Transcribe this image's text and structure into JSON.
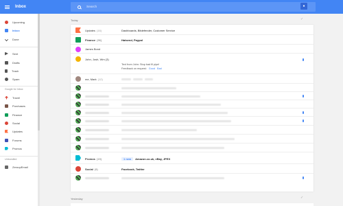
{
  "header": {
    "app_title": "Inbox",
    "search_placeholder": "Search"
  },
  "sidebar": {
    "items": [
      {
        "label": "Upcoming",
        "icon": "clock-icon",
        "color": "#db4437"
      },
      {
        "label": "Inbox",
        "icon": "inbox-icon",
        "color": "#4285f4",
        "active": true
      },
      {
        "label": "Done",
        "icon": "check-icon",
        "color": "#0f9d58"
      },
      {
        "label": "Sent",
        "icon": "send-icon",
        "color": "#555555"
      },
      {
        "label": "Drafts",
        "icon": "drafts-icon",
        "color": "#555555"
      },
      {
        "label": "Trash",
        "icon": "trash-icon",
        "color": "#555555"
      },
      {
        "label": "Spam",
        "icon": "spam-icon",
        "color": "#555555"
      }
    ],
    "bundles_header": "Google for Inbox",
    "bundles": [
      {
        "label": "Travel",
        "icon": "plane-icon",
        "color": "#db4437"
      },
      {
        "label": "Purchases",
        "icon": "cart-icon",
        "color": "#795548"
      },
      {
        "label": "Finance",
        "icon": "finance-icon",
        "color": "#0f9d58"
      },
      {
        "label": "Social",
        "icon": "social-icon",
        "color": "#db4437"
      },
      {
        "label": "Updates",
        "icon": "flag-icon",
        "color": "#ff7043"
      },
      {
        "label": "Forums",
        "icon": "forum-icon",
        "color": "#3f51b5"
      },
      {
        "label": "Promos",
        "icon": "tag-icon",
        "color": "#00bcd4"
      }
    ],
    "unbundled_header": "Unbundled",
    "unbundled": [
      {
        "label": "ZeroupEmail",
        "icon": "label-icon",
        "color": "#666666"
      }
    ]
  },
  "main": {
    "today_label": "Today",
    "yesterday_label": "Yesterday",
    "rows": [
      {
        "sender": "Updates",
        "count": "(16)",
        "summary": "Dashboards, Bitdefender, Customer Service",
        "bold": false,
        "avatar_color": "#ff7043"
      },
      {
        "sender": "Finance",
        "count": "(96)",
        "summary": "Hatsend, Paypal",
        "bold": true,
        "avatar_color": "#0f9d58"
      },
      {
        "sender": "James Bond",
        "count": "",
        "summary": "",
        "bold": false,
        "avatar_color": "#e040fb"
      },
      {
        "sender": "John, Josh, Wm (3)",
        "count": "",
        "summary": "",
        "bold": false,
        "avatar_color": "#f4b400",
        "line2": "Text from John: Stop bad fil pipe!",
        "line3_prefix": "Feedback on request:",
        "link1": "Good",
        "link2": "Bad"
      },
      {
        "sender": "me, Mark",
        "count": "(12)",
        "summary": "",
        "bold": false,
        "avatar_color": "#a1887f"
      },
      {
        "sender": "Promos",
        "count": "(15)",
        "summary": "Amazon.co.uk, eBay, JPEX",
        "chip": "1 new",
        "bold": true,
        "avatar_color": "#00bcd4"
      },
      {
        "sender": "Social",
        "count": "(9)",
        "summary": "Facebook, Twitter",
        "bold": true,
        "avatar_color": "#db4437"
      }
    ]
  }
}
